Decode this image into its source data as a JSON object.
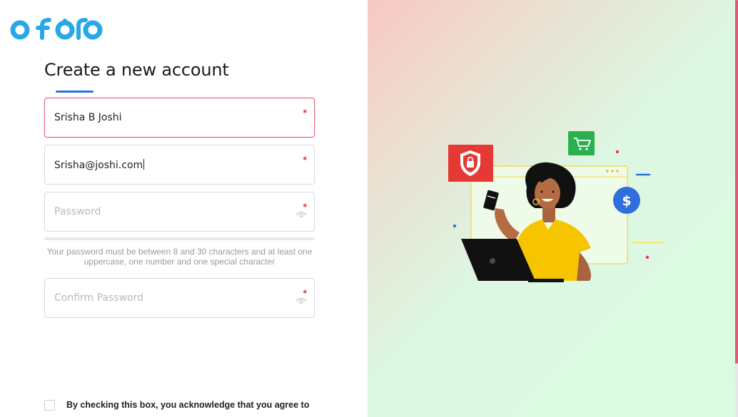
{
  "brand": {
    "logo_text": "ofofo",
    "color": "#29a8e8"
  },
  "page": {
    "title": "Create a new account"
  },
  "form": {
    "name": {
      "value": "Srisha B Joshi",
      "required_mark": "*"
    },
    "email": {
      "value": "Srisha@joshi.com",
      "required_mark": "*"
    },
    "password": {
      "placeholder": "Password",
      "required_mark": "*",
      "icon": "eye-icon"
    },
    "password_hint": "Your password must be between 8 and 30 characters and at least one uppercase, one number and one special character",
    "confirm_password": {
      "placeholder": "Confirm Password",
      "required_mark": "*",
      "icon": "eye-icon"
    },
    "agree_text": "By checking this box, you acknowledge that you agree to"
  },
  "colors": {
    "accent": "#2a72d9",
    "active_border": "#e0637c",
    "required": "#e23b3b",
    "scroll_thumb": "#e25877"
  },
  "illustration": {
    "icons": [
      "shield-lock-icon",
      "shopping-cart-icon",
      "dollar-coin-icon",
      "credit-card-icon",
      "laptop-icon"
    ]
  }
}
